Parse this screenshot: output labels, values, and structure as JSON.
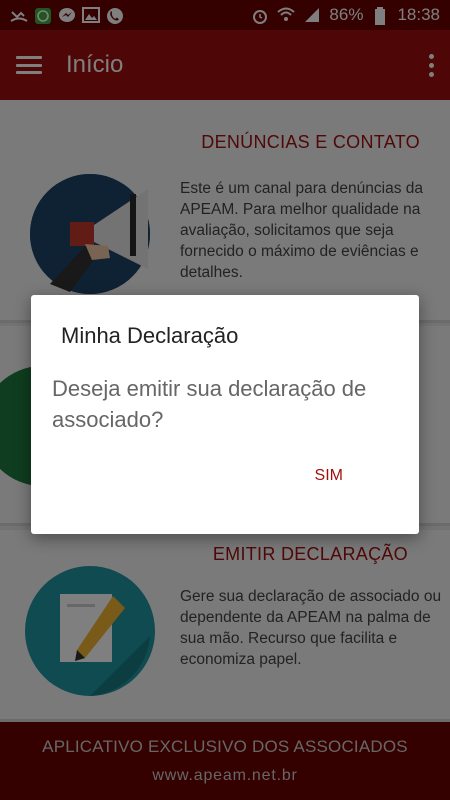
{
  "status_bar": {
    "battery": "86%",
    "time": "18:38",
    "icons": [
      "missed-call-icon",
      "whatsapp-icon",
      "messenger-icon",
      "gallery-icon",
      "phone-icon",
      "alarm-icon",
      "wifi-icon",
      "signal-icon",
      "battery-icon"
    ]
  },
  "app_bar": {
    "title": "Início",
    "menu_icon": "hamburger-menu-icon",
    "overflow_icon": "more-vert-icon"
  },
  "cards": [
    {
      "title": "DENÚNCIAS E CONTATO",
      "text": "Este é um canal para denúncias da APEAM. Para melhor qualidade na avaliação, solicitamos que seja fornecido o máximo de eviências e detalhes.",
      "image": "megaphone-icon"
    },
    {
      "title": "",
      "text": "",
      "image": "green-circle-icon"
    },
    {
      "title": "EMITIR DECLARAÇÃO",
      "text": "Gere sua declaração de associado ou dependente da APEAM na palma de sua mão. Recurso que facilita e economiza papel.",
      "image": "pen-document-icon"
    }
  ],
  "dialog": {
    "title": "Minha Declaração",
    "message": "Deseja emitir sua declaração de associado?",
    "confirm_label": "SIM"
  },
  "footer": {
    "title": "APLICATIVO EXCLUSIVO DOS ASSOCIADOS",
    "url": "www.apeam.net.br"
  },
  "colors": {
    "primary": "#9d0d0d",
    "primary_dark": "#6b0000",
    "accent_text": "#a01010"
  }
}
